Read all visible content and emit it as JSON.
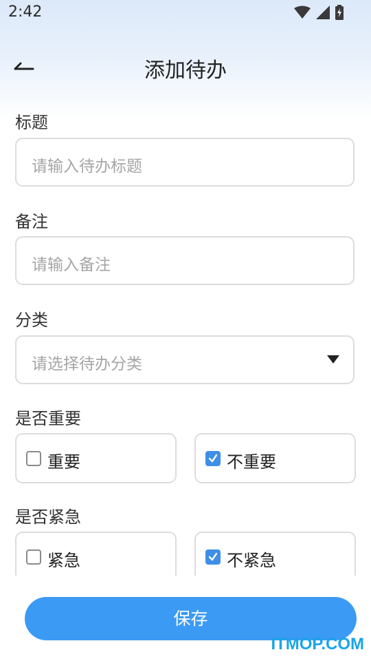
{
  "status": {
    "time": "2:42"
  },
  "header": {
    "title": "添加待办"
  },
  "form": {
    "title_label": "标题",
    "title_placeholder": "请输入待办标题",
    "note_label": "备注",
    "note_placeholder": "请输入备注",
    "category_label": "分类",
    "category_placeholder": "请选择待办分类",
    "important_label": "是否重要",
    "important_options": [
      {
        "label": "重要",
        "checked": false
      },
      {
        "label": "不重要",
        "checked": true
      }
    ],
    "urgent_label": "是否紧急",
    "urgent_options": [
      {
        "label": "紧急",
        "checked": false
      },
      {
        "label": "不紧急",
        "checked": true
      }
    ]
  },
  "actions": {
    "save_label": "保存"
  },
  "watermark": "ITMOP.COM",
  "colors": {
    "accent": "#3b9af4",
    "checkbox": "#3f8fe6",
    "watermark": "#19a5e8"
  }
}
